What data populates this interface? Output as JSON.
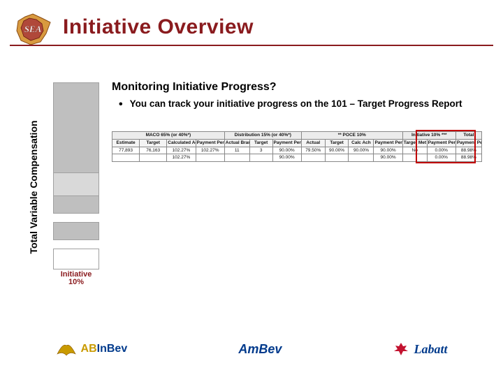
{
  "title": "Initiative Overview",
  "y_axis_label": "Total Variable Compensation",
  "bar_caption": "Initiative 10%",
  "content": {
    "subtitle": "Monitoring Initiative Progress?",
    "bullet": "You can track your initiative progress on the 101 – Target Progress Report"
  },
  "report": {
    "section_headers": {
      "maco": "MACO 65% (or 40%*)",
      "dist": "Distribution 15% (or 40%*)",
      "poce": "** POCE 10%",
      "init": "Initiative 10% ***",
      "total": "Total"
    },
    "col_headers": {
      "estimate": "Estimate",
      "target": "Target",
      "calc_ach": "Calculated Achievement",
      "pay_pct": "Payment Percentage",
      "actual_brand": "Actual Brand",
      "target2": "Target",
      "pay_pct2": "Payment Percentage",
      "actual": "Actual",
      "target3": "Target",
      "calc_ach2": "Calc Ach",
      "pay_pct3": "Payment Percentage",
      "target_met": "Target Met",
      "pay_pct4": "Payment Percentage",
      "pay_pct_total": "Payment Percentage"
    },
    "row1": {
      "estimate": "77,893",
      "target": "76,163",
      "calc_ach": "102.27%",
      "pay_pct": "102.27%",
      "actual_brand": "11",
      "target2": "3",
      "pay_pct2": "90.00%",
      "actual": "79.50%",
      "target3": "90.00%",
      "calc_ach2": "90.00%",
      "pay_pct3": "90.00%",
      "target_met": "No",
      "pay_pct4": "0.00%",
      "pay_pct_total": "88.98%"
    },
    "row2": {
      "calc_ach": "102.27%",
      "pay_pct2": "90.00%",
      "pay_pct3": "90.00%",
      "pay_pct4": "0.00%",
      "pay_pct_total": "88.98%"
    }
  },
  "footer_brands": {
    "abinbev_1": "AB",
    "abinbev_2": "InBev",
    "ambev": "AmBev",
    "labatt": "Labatt"
  },
  "logo_text": "SEA"
}
